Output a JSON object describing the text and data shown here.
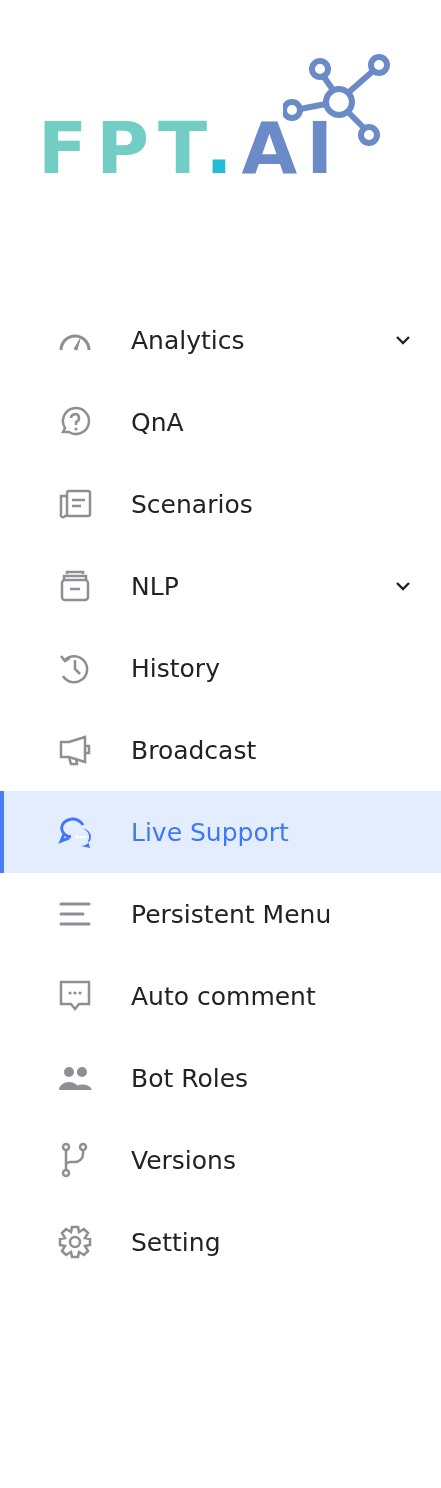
{
  "logo": {
    "parts": [
      "FPT",
      ".",
      "AI"
    ]
  },
  "menu": [
    {
      "label": "Analytics",
      "selected": false,
      "expanded": false
    },
    {
      "label": "QnA",
      "selected": false
    },
    {
      "label": "Scenarios",
      "selected": false
    },
    {
      "label": "NLP",
      "selected": false,
      "expanded": false
    },
    {
      "label": "History",
      "selected": false
    },
    {
      "label": "Broadcast",
      "selected": false
    },
    {
      "label": "Live Support",
      "selected": true
    },
    {
      "label": "Persistent Menu",
      "selected": false
    },
    {
      "label": "Auto comment",
      "selected": false
    },
    {
      "label": "Bot Roles",
      "selected": false
    },
    {
      "label": "Versions",
      "selected": false
    },
    {
      "label": "Setting",
      "selected": false
    }
  ]
}
